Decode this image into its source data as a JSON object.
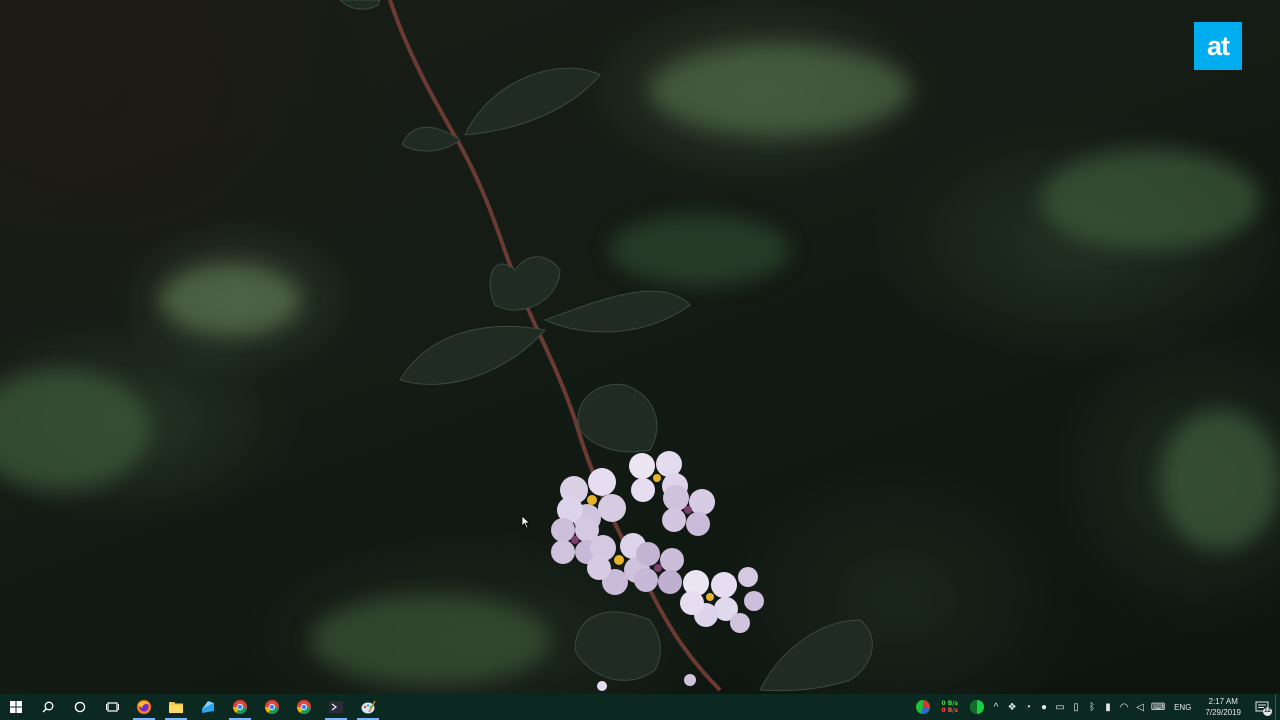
{
  "desktop": {
    "logo_text": "at",
    "logo_color": "#00aeef"
  },
  "taskbar": {
    "background": "#0c2921",
    "pinned": [
      {
        "name": "start-icon"
      },
      {
        "name": "search-icon"
      },
      {
        "name": "cortana-icon"
      },
      {
        "name": "task-view-icon"
      },
      {
        "name": "firefox-icon"
      },
      {
        "name": "file-explorer-icon"
      },
      {
        "name": "app-icon"
      },
      {
        "name": "chrome-icon"
      },
      {
        "name": "chrome-icon"
      },
      {
        "name": "chrome-icon"
      },
      {
        "name": "terminal-icon"
      },
      {
        "name": "paint-icon"
      }
    ],
    "tray": {
      "net_up": "0 B/s",
      "net_down": "0 B/s",
      "language": "ENG",
      "time": "2:17 AM",
      "date": "7/29/2019",
      "notification_count": "12"
    }
  }
}
